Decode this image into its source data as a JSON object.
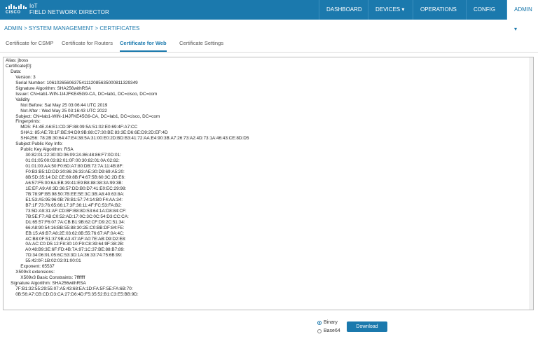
{
  "header": {
    "logo_text": "CISCO",
    "product_line1": "IoT",
    "product_line2": "FIELD NETWORK DIRECTOR",
    "nav": [
      {
        "label": "DASHBOARD"
      },
      {
        "label": "DEVICES ▾"
      },
      {
        "label": "OPERATIONS ▾"
      },
      {
        "label": "CONFIG ▾"
      },
      {
        "label": "ADMIN ▾"
      }
    ]
  },
  "breadcrumb": "ADMIN > SYSTEM MANAGEMENT > CERTIFICATES",
  "tabs": [
    {
      "label": "Certificate for CSMP"
    },
    {
      "label": "Certificate for Routers"
    },
    {
      "label": "Certificate for Web"
    },
    {
      "label": "Certificate Settings"
    }
  ],
  "certificate_lines": [
    "Alias: jboss",
    "Certificate[0]:",
    "    Data:",
    "        Version: 3",
    "        Serial Number: 1061026560637541112085635000811329349",
    "        Signature Algorithm: SHA256withRSA",
    "        Issuer: CN=lab1-WIN-1I4JFKE45G9-CA, DC=lab1, DC=cisco, DC=com",
    "        Validity",
    "            Not Before: Sat May 25 03:06:44 UTC 2019",
    "            Not After : Wed May 25 03:16:43 UTC 2022",
    "        Subject: CN=lab1-WIN-1I4JFKE45G9-CA, DC=lab1, DC=cisco, DC=com",
    "        Fingerprints:",
    "            MD5: F4:4E:A6:E1:CD:3F:88:09:5A:51:02:E0:69:4F:A7:CC",
    "            SHA1: 85:AE:78:1F:BE:94:D9:9B:88:C7:30:BE:83:3E:D6:6E:D9:2D:EF:4D",
    "            SHA256: 78:2B:30:64:47:E4:38:5A:31:00:E0:2D:BD:B3:41:72:AA:E4:90:3B:A7:26:73:A2:4D:73:1A:46:43:CE:8D:D5",
    "        Subject Public Key Info:",
    "            Public Key Algorithm: RSA",
    "                30:82:01:22:30:0D:06:09:2A:86:48:86:F7:0D:01:",
    "                01:01:05:00:03:82:01:0F:00:30:82:01:0A:02:82:",
    "                01:01:00:AA:50:F0:6D:A7:80:DB:72:7A:11:4B:8F:",
    "                F0:B3:B5:1D:DD:30:86:26:33:AE:30:D9:69:A5:20:",
    "                8B:5D:35:14:D2:CE:69:8B:F4:67:5B:60:3C:2D:E6:",
    "                A6:57:F5:00:6A:EB:39:41:E9:B8:88:38:3A:99:3B:",
    "                1E:EF:A9:A0:3D:36:57:DD:B0:D7:41:E0:EC:29:98:",
    "                7B:78:9F:B5:98:50:7B:EE:5E:3C:3B:A8:40:63:8A:",
    "                E1:53:A5:95:96:0B:78:B1:57:74:14:B0:F4:AA:34:",
    "                B7:1F:73:76:65:66:17:3F:36:11:4F:FC:53:FA:B2:",
    "                73:5D:A9:31:AF:CD:BF:B8:8D:53:64:1A:D8:84:CF:",
    "                7B:5E:F7:AB:C0:52:AD:17:0C:3C:0C:54:D3:CC:CA:",
    "                D1:65:57:F6:07:7A:CB:B1:9B:62:CF:D9:2C:51:34:",
    "                66:A8:90:54:16:BB:55:88:30:2E:C0:BB:DF:84:FE:",
    "                EB:15:A9:B7:A8:2E:03:62:8B:55:76:67:AF:0A:4C:",
    "                4C:B8:0F:51:37:9B:A3:47:AF:A0:7E:AB:D9:D2:E8:",
    "                0A:AC:C0:D5:12:F8:30:10:F9:C8:39:64:9F:38:2B:",
    "                A0:48:B9:3E:6F:FD:4B:7A:97:1C:37:BE:88:B7:89:",
    "                7D:34:06:91:05:6C:53:3D:1A:36:33:74:75:6B:99:",
    "                55:42:0F:1B:02:03:01:00:01",
    "            Exponent: 65537",
    "        X509v3 extensions:",
    "            X509v3 Basic Constraints: 7fffffff",
    "    Signature Algorithm: SHA256withRSA",
    "        7F:B1:32:55:29:55:07:A5:43:68:EA:1D:FA:5F:5E:FA:6B:70:",
    "        0B:56:A7:CB:CD:D3:CA:27:D6:4D:F5:35:52:B1:C3:E5:BB:9D:"
  ],
  "format_options": [
    {
      "label": "Binary",
      "selected": true
    },
    {
      "label": "Base64",
      "selected": false
    }
  ],
  "download_label": "Download",
  "colors": {
    "accent": "#1b79ad"
  }
}
